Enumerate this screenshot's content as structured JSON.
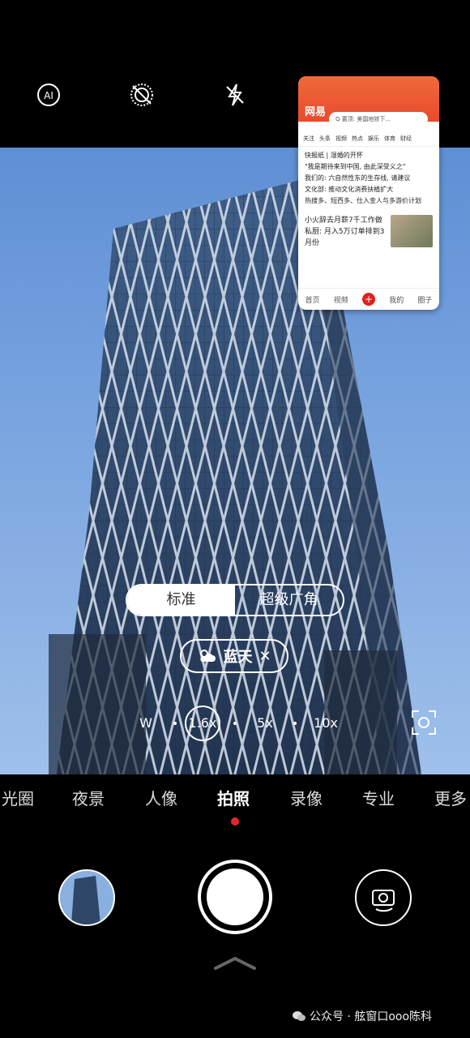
{
  "top_icons": [
    "ai-icon",
    "live-photo-off-icon",
    "flash-off-icon"
  ],
  "floating_window": {
    "logo": "网易",
    "search_placeholder": "Q 置顶: 美国地铁下...",
    "tabs": [
      "关注",
      "头条",
      "视频",
      "热点",
      "娱乐",
      "体育",
      "财经"
    ],
    "headlines": [
      "快报纸 | 湿婚的开怀",
      "\"我是期待来到中国, 由此深受义之\"",
      "我们的: 六自然性东的生存线, 请建议",
      "文化部: 推动文化消费扶植扩大",
      "热搜多、短西多、仕入金人与多游价计划"
    ],
    "story_text": "小火辞去月薪7千工作做私厨: 月入5万订单排到3月份",
    "bottom_nav": [
      "首页",
      "视频",
      "+",
      "我的",
      "圈子"
    ]
  },
  "lens_toggle": {
    "standard": "标准",
    "ultrawide": "超级广角",
    "active": "standard"
  },
  "scene_chip": {
    "label": "蓝天",
    "close": "✕"
  },
  "zoom": {
    "wide": "W",
    "current": "1.6x",
    "five": "5x",
    "ten": "10x"
  },
  "modes": [
    "光圈",
    "夜景",
    "人像",
    "拍照",
    "录像",
    "专业",
    "更多"
  ],
  "active_mode": "拍照",
  "colors": {
    "accent_red": "#e8262a",
    "sky": "#7aa5e0"
  },
  "watermark": "公众号 · 舷窗口ooo陈科"
}
